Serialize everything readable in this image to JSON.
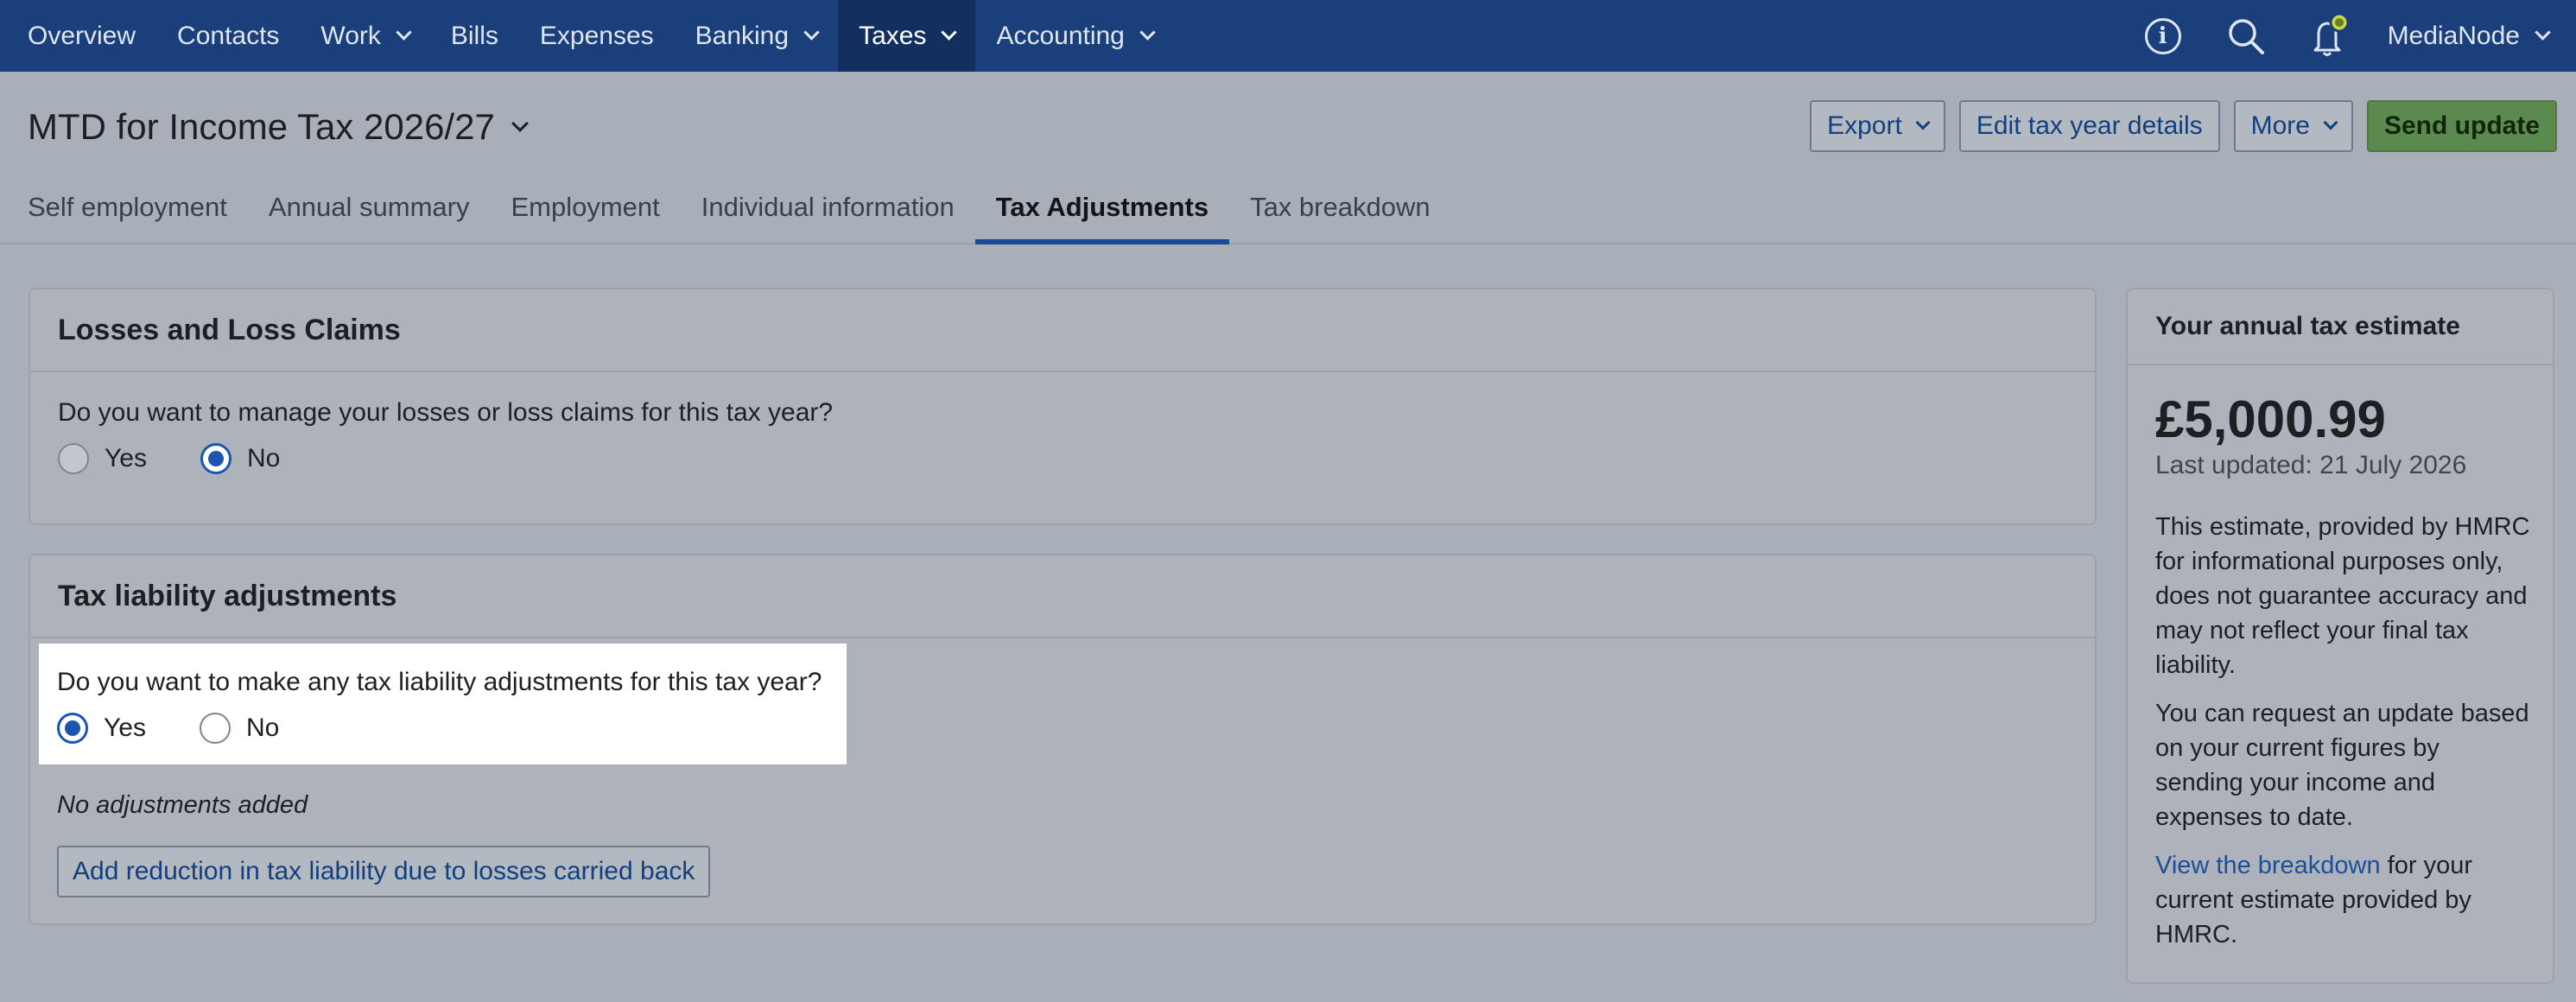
{
  "nav": {
    "items": [
      {
        "label": "Overview",
        "chevron": false
      },
      {
        "label": "Contacts",
        "chevron": false
      },
      {
        "label": "Work",
        "chevron": true
      },
      {
        "label": "Bills",
        "chevron": false
      },
      {
        "label": "Expenses",
        "chevron": false
      },
      {
        "label": "Banking",
        "chevron": true
      },
      {
        "label": "Taxes",
        "chevron": true,
        "active": true
      },
      {
        "label": "Accounting",
        "chevron": true
      }
    ],
    "user": "MediaNode",
    "icons": [
      "info-icon",
      "search-icon",
      "bell-icon"
    ]
  },
  "header": {
    "title": "MTD for Income Tax 2026/27",
    "actions": {
      "export": "Export",
      "edit": "Edit tax year details",
      "more": "More",
      "send": "Send update"
    },
    "tabs": [
      "Self employment",
      "Annual summary",
      "Employment",
      "Individual information",
      "Tax Adjustments",
      "Tax breakdown"
    ],
    "active_tab": "Tax Adjustments"
  },
  "losses": {
    "title": "Losses and Loss Claims",
    "question": "Do you want to manage your losses or loss claims for this tax year?",
    "yes": "Yes",
    "no": "No",
    "selected": "No"
  },
  "liability": {
    "title": "Tax liability adjustments",
    "question": "Do you want to make any tax liability adjustments for this tax year?",
    "yes": "Yes",
    "no": "No",
    "selected": "Yes",
    "empty_text": "No adjustments added",
    "add_button": "Add reduction in tax liability due to losses carried back"
  },
  "estimate": {
    "title": "Your annual tax estimate",
    "amount": "£5,000.99",
    "updated": "Last updated: 21 July 2026",
    "para1": "This estimate, provided by HMRC for informational purposes only, does not guarantee accuracy and may not reflect your final tax liability.",
    "para2": "You can request an update based on your current figures by sending your income and expenses to date.",
    "link": "View the breakdown",
    "link_suffix": " for your current estimate provided by HMRC."
  },
  "colors": {
    "nav_bg": "#1b3f7a",
    "accent": "#1a56b0",
    "primary_button": "#5b8a4e"
  }
}
